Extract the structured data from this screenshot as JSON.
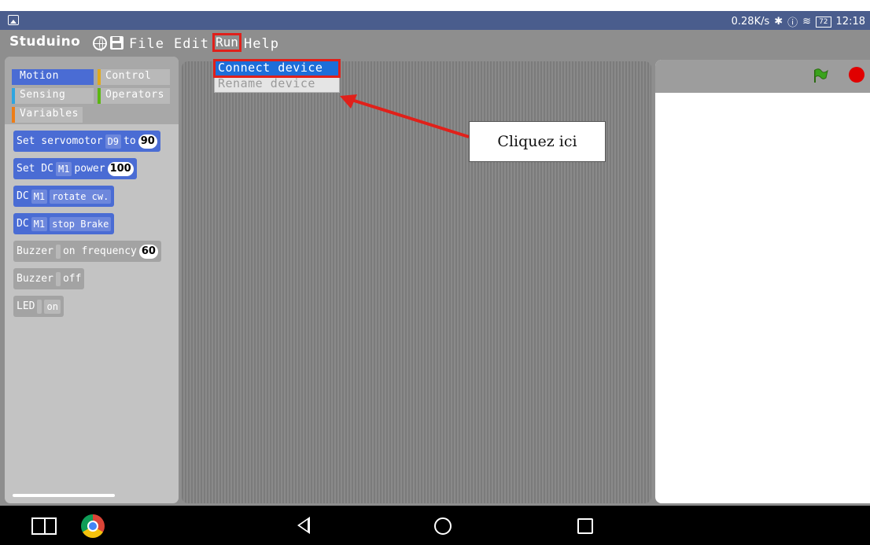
{
  "statusbar": {
    "speed": "0.28K/s",
    "battery": "72",
    "time": "12:18"
  },
  "menubar": {
    "logo": "Studuino",
    "file": "File",
    "edit": "Edit",
    "run": "Run",
    "help": "Help"
  },
  "run_menu": {
    "items": [
      "Connect device",
      "Rename device"
    ]
  },
  "palette": {
    "categories": {
      "motion": "Motion",
      "control": "Control",
      "sensing": "Sensing",
      "operators": "Operators",
      "variables": "Variables"
    },
    "blocks": [
      {
        "pre": "Set servomotor",
        "slot": "D9",
        "mid": "to",
        "value": "90"
      },
      {
        "pre": "Set DC",
        "slot": "M1",
        "mid": "power",
        "value": "100"
      },
      {
        "pre": "DC",
        "slot": "M1",
        "mid": "rotate cw."
      },
      {
        "pre": "DC",
        "slot": "M1",
        "mid": "stop Brake"
      },
      {
        "pre": "Buzzer",
        "mid": "on frequency",
        "value": "60"
      },
      {
        "pre": "Buzzer",
        "mid": "off"
      },
      {
        "pre": "LED",
        "mid": "on"
      }
    ]
  },
  "annotation": {
    "text": "Cliquez ici"
  },
  "colors": {
    "highlight": "#e0201a",
    "motion": "#4a6cd4",
    "statusbar": "#4a5d8d"
  }
}
